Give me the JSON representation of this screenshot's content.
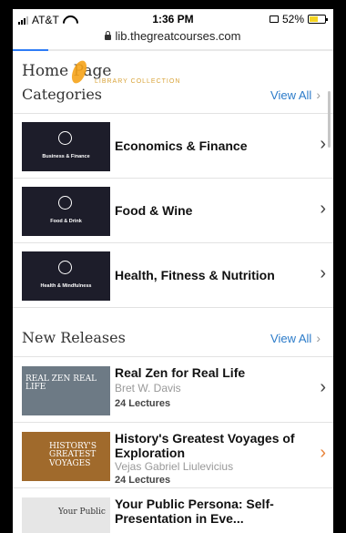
{
  "status_bar": {
    "carrier": "AT&T",
    "time": "1:36 PM",
    "battery_pct": "52%",
    "battery_level": 0.52
  },
  "url_bar": {
    "url": "lib.thegreatcourses.com",
    "load_progress": 0.11
  },
  "header": {
    "title": "Home Page",
    "subtitle": "LIBRARY COLLECTION"
  },
  "categories": {
    "title": "Categories",
    "view_all": "View All",
    "items": [
      {
        "name": "Economics & Finance",
        "thumb_caption": "Business & Finance"
      },
      {
        "name": "Food & Wine",
        "thumb_caption": "Food & Drink"
      },
      {
        "name": "Health, Fitness & Nutrition",
        "thumb_caption": "Health & Mindfulness"
      }
    ]
  },
  "new_releases": {
    "title": "New Releases",
    "view_all": "View All",
    "items": [
      {
        "title": "Real Zen for Real Life",
        "author": "Bret W. Davis",
        "lectures": "24 Lectures",
        "thumb_text": "REAL ZEN REAL LIFE",
        "thumb_color": "#6d7a85"
      },
      {
        "title": "History's Greatest Voyages of Exploration",
        "author": "Vejas Gabriel Liulevicius",
        "lectures": "24 Lectures",
        "thumb_text": "HISTORY'S GREATEST VOYAGES",
        "thumb_color": "#a06a2c"
      },
      {
        "title": "Your Public Persona: Self-Presentation in Eve...",
        "author": "",
        "lectures": "",
        "thumb_text": "Your Public",
        "thumb_color": "#e6e6e6"
      }
    ]
  },
  "colors": {
    "link": "#2b7bc9",
    "accent": "#f5a31a",
    "progress": "#2e7cf6"
  }
}
